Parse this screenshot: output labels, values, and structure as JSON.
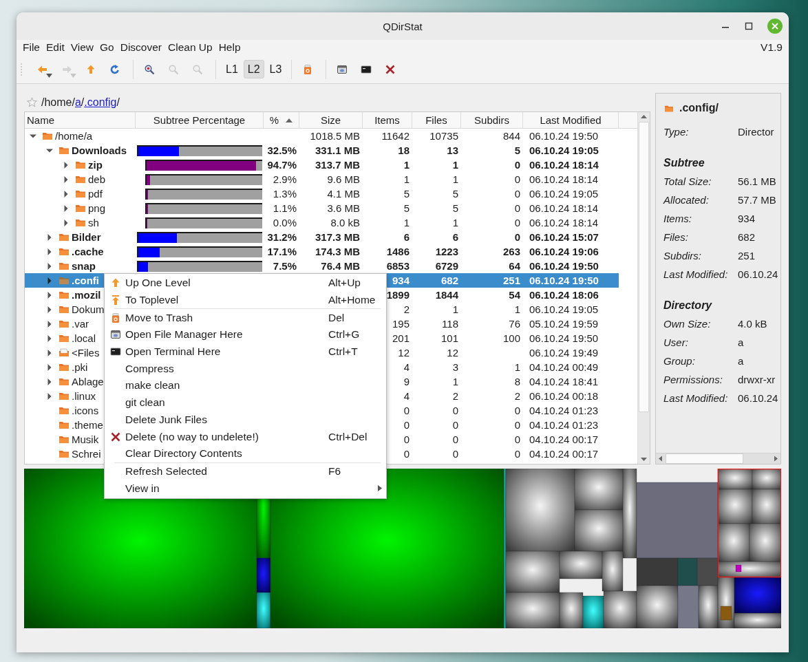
{
  "window": {
    "title": "QDirStat"
  },
  "menu_bar": {
    "items": [
      "File",
      "Edit",
      "View",
      "Go",
      "Discover",
      "Clean Up",
      "Help"
    ],
    "version": "V1.9"
  },
  "toolbar": [
    {
      "kind": "button",
      "dropdown": true,
      "disabled": false
    },
    {
      "kind": "button",
      "dropdown": true,
      "disabled": true
    },
    {
      "kind": "button",
      "dropdown": false,
      "disabled": false
    },
    {
      "kind": "button",
      "dropdown": false,
      "disabled": false
    },
    {
      "kind": "separator"
    },
    {
      "kind": "button",
      "dropdown": false,
      "disabled": false
    },
    {
      "kind": "button",
      "dropdown": false,
      "disabled": true
    },
    {
      "kind": "button",
      "dropdown": false,
      "disabled": true
    },
    {
      "kind": "separator"
    },
    {
      "kind": "level",
      "label": "L1",
      "selected": false
    },
    {
      "kind": "level",
      "label": "L2",
      "selected": true
    },
    {
      "kind": "level",
      "label": "L3",
      "selected": false
    },
    {
      "kind": "separator"
    },
    {
      "kind": "button",
      "dropdown": false,
      "disabled": false
    },
    {
      "kind": "separator"
    },
    {
      "kind": "button",
      "dropdown": false,
      "disabled": false
    },
    {
      "kind": "button",
      "dropdown": false,
      "disabled": false
    },
    {
      "kind": "button",
      "dropdown": false,
      "disabled": false
    }
  ],
  "breadcrumb": [
    {
      "text": "/home/",
      "link": false
    },
    {
      "text": "a",
      "link": true
    },
    {
      "text": "/",
      "link": false
    },
    {
      "text": ".config",
      "link": true
    },
    {
      "text": "/",
      "link": false
    }
  ],
  "tree": {
    "columns": [
      {
        "label": "Name",
        "sorted": false
      },
      {
        "label": "Subtree Percentage",
        "sorted": false
      },
      {
        "label": "%",
        "sorted": true
      },
      {
        "label": "Size",
        "sorted": false
      },
      {
        "label": "Items",
        "sorted": false
      },
      {
        "label": "Files",
        "sorted": false
      },
      {
        "label": "Subdirs",
        "sorted": false
      },
      {
        "label": "Last Modified",
        "sorted": false
      }
    ],
    "rows": [
      {
        "name": "/home/a",
        "kind": "folder",
        "expanded": true,
        "bold": false,
        "selected": false,
        "size": "1018.5 MB",
        "items": "11642",
        "files": "10735",
        "subdirs": "844",
        "modified": "06.10.24 19:50",
        "children": [
          {
            "name": "Downloads",
            "kind": "folder",
            "expanded": true,
            "bold": true,
            "selected": false,
            "level": 0.325,
            "percent": "32.5%",
            "size": "331.1 MB",
            "items": "18",
            "files": "13",
            "subdirs": "5",
            "modified": "06.10.24 19:05",
            "children": [
              {
                "name": "zip",
                "kind": "folder",
                "expanded": false,
                "bold": true,
                "selected": false,
                "level": 0.947,
                "percent": "94.7%",
                "size": "313.7 MB",
                "items": "1",
                "files": "1",
                "subdirs": "0",
                "modified": "06.10.24 18:14"
              },
              {
                "name": "deb",
                "kind": "folder",
                "expanded": false,
                "bold": false,
                "selected": false,
                "level": 0.029,
                "percent": "2.9%",
                "size": "9.6 MB",
                "items": "1",
                "files": "1",
                "subdirs": "0",
                "modified": "06.10.24 18:14"
              },
              {
                "name": "pdf",
                "kind": "folder",
                "expanded": false,
                "bold": false,
                "selected": false,
                "level": 0.013,
                "percent": "1.3%",
                "size": "4.1 MB",
                "items": "5",
                "files": "5",
                "subdirs": "0",
                "modified": "06.10.24 19:05"
              },
              {
                "name": "png",
                "kind": "folder",
                "expanded": false,
                "bold": false,
                "selected": false,
                "level": 0.011,
                "percent": "1.1%",
                "size": "3.6 MB",
                "items": "5",
                "files": "5",
                "subdirs": "0",
                "modified": "06.10.24 18:14"
              },
              {
                "name": "sh",
                "kind": "folder",
                "expanded": false,
                "bold": false,
                "selected": false,
                "level": 0.0,
                "percent": "0.0%",
                "size": "8.0 kB",
                "items": "1",
                "files": "1",
                "subdirs": "0",
                "modified": "06.10.24 18:14"
              }
            ]
          },
          {
            "name": "Bilder",
            "kind": "folder",
            "expanded": false,
            "bold": true,
            "selected": false,
            "level": 0.312,
            "percent": "31.2%",
            "size": "317.3 MB",
            "items": "6",
            "files": "6",
            "subdirs": "0",
            "modified": "06.10.24 15:07"
          },
          {
            "name": ".cache",
            "kind": "folder",
            "expanded": false,
            "bold": true,
            "selected": false,
            "level": 0.171,
            "percent": "17.1%",
            "size": "174.3 MB",
            "items": "1486",
            "files": "1223",
            "subdirs": "263",
            "modified": "06.10.24 19:06"
          },
          {
            "name": "snap",
            "kind": "folder",
            "expanded": false,
            "bold": true,
            "selected": false,
            "level": 0.075,
            "percent": "7.5%",
            "size": "76.4 MB",
            "items": "6853",
            "files": "6729",
            "subdirs": "64",
            "modified": "06.10.24 19:50"
          },
          {
            "name": ".confi",
            "kind": "folder",
            "expanded": false,
            "bold": true,
            "selected": true,
            "items": "934",
            "files": "682",
            "subdirs": "251",
            "modified": "06.10.24 19:50"
          },
          {
            "name": ".mozil",
            "kind": "folder",
            "expanded": false,
            "bold": true,
            "selected": false,
            "items": "1899",
            "files": "1844",
            "subdirs": "54",
            "modified": "06.10.24 18:06"
          },
          {
            "name": "Dokum",
            "kind": "folder",
            "expanded": false,
            "bold": false,
            "selected": false,
            "items": "2",
            "files": "1",
            "subdirs": "1",
            "modified": "06.10.24 19:05"
          },
          {
            "name": ".var",
            "kind": "folder",
            "expanded": false,
            "bold": false,
            "selected": false,
            "items": "195",
            "files": "118",
            "subdirs": "76",
            "modified": "05.10.24 19:59"
          },
          {
            "name": ".local",
            "kind": "folder",
            "expanded": false,
            "bold": false,
            "selected": false,
            "items": "201",
            "files": "101",
            "subdirs": "100",
            "modified": "06.10.24 19:50"
          },
          {
            "name": "<Files",
            "kind": "files",
            "expanded": false,
            "bold": false,
            "selected": false,
            "items": "12",
            "files": "12",
            "modified": "06.10.24 19:49"
          },
          {
            "name": ".pki",
            "kind": "folder",
            "expanded": false,
            "bold": false,
            "selected": false,
            "items": "4",
            "files": "3",
            "subdirs": "1",
            "modified": "04.10.24 00:49"
          },
          {
            "name": "Ablage",
            "kind": "folder",
            "expanded": false,
            "bold": false,
            "selected": false,
            "items": "9",
            "files": "1",
            "subdirs": "8",
            "modified": "04.10.24 18:41"
          },
          {
            "name": ".linux",
            "kind": "folder",
            "expanded": false,
            "bold": false,
            "selected": false,
            "items": "4",
            "files": "2",
            "subdirs": "2",
            "modified": "06.10.24 00:18"
          },
          {
            "name": ".icons",
            "kind": "leaf",
            "bold": false,
            "selected": false,
            "items": "0",
            "files": "0",
            "subdirs": "0",
            "modified": "04.10.24 01:23"
          },
          {
            "name": ".theme",
            "kind": "leaf",
            "bold": false,
            "selected": false,
            "items": "0",
            "files": "0",
            "subdirs": "0",
            "modified": "04.10.24 01:23"
          },
          {
            "name": "Musik",
            "kind": "leaf",
            "bold": false,
            "selected": false,
            "items": "0",
            "files": "0",
            "subdirs": "0",
            "modified": "04.10.24 00:17"
          },
          {
            "name": "Schrei",
            "kind": "leaf",
            "bold": false,
            "selected": false,
            "items": "0",
            "files": "0",
            "subdirs": "0",
            "modified": "04.10.24 00:17"
          }
        ]
      }
    ]
  },
  "context_menu": [
    {
      "kind": "item",
      "label": "Up One Level",
      "shortcut": "Alt+Up",
      "submenu": false
    },
    {
      "kind": "item",
      "label": "To Toplevel",
      "shortcut": "Alt+Home",
      "submenu": false
    },
    {
      "kind": "separator"
    },
    {
      "kind": "item",
      "label": "Move to Trash",
      "shortcut": "Del",
      "submenu": false
    },
    {
      "kind": "item",
      "label": "Open File Manager Here",
      "shortcut": "Ctrl+G",
      "submenu": false
    },
    {
      "kind": "item",
      "label": "Open Terminal Here",
      "shortcut": "Ctrl+T",
      "submenu": false
    },
    {
      "kind": "item",
      "label": "Compress",
      "submenu": false
    },
    {
      "kind": "item",
      "label": "make clean",
      "submenu": false
    },
    {
      "kind": "item",
      "label": "git clean",
      "submenu": false
    },
    {
      "kind": "item",
      "label": "Delete Junk Files",
      "submenu": false
    },
    {
      "kind": "item",
      "label": "Delete (no way to undelete!)",
      "shortcut": "Ctrl+Del",
      "submenu": false
    },
    {
      "kind": "item",
      "label": "Clear Directory Contents",
      "submenu": false
    },
    {
      "kind": "separator"
    },
    {
      "kind": "item",
      "label": "Refresh Selected",
      "shortcut": "F6",
      "submenu": false
    },
    {
      "kind": "item",
      "label": "View in",
      "submenu": true
    }
  ],
  "details": {
    "title": ".config/",
    "items": [
      {
        "kind": "field",
        "label": "Type:",
        "value": "Director"
      },
      {
        "kind": "heading",
        "label": "Subtree"
      },
      {
        "kind": "field",
        "label": "Total Size:",
        "value": "56.1 MB"
      },
      {
        "kind": "field",
        "label": "Allocated:",
        "value": "57.7 MB"
      },
      {
        "kind": "field",
        "label": "Items:",
        "value": "934"
      },
      {
        "kind": "field",
        "label": "Files:",
        "value": "682"
      },
      {
        "kind": "field",
        "label": "Subdirs:",
        "value": "251"
      },
      {
        "kind": "field",
        "label": "Last Modified:",
        "value": "06.10.24"
      },
      {
        "kind": "heading",
        "label": "Directory"
      },
      {
        "kind": "field",
        "label": "Own Size:",
        "value": "4.0 kB"
      },
      {
        "kind": "field",
        "label": "User:",
        "value": "a"
      },
      {
        "kind": "field",
        "label": "Group:",
        "value": "a"
      },
      {
        "kind": "field",
        "label": "Permissions:",
        "value": "drwxr-xr"
      },
      {
        "kind": "field",
        "label": "Last Modified:",
        "value": "06.10.24"
      }
    ]
  }
}
